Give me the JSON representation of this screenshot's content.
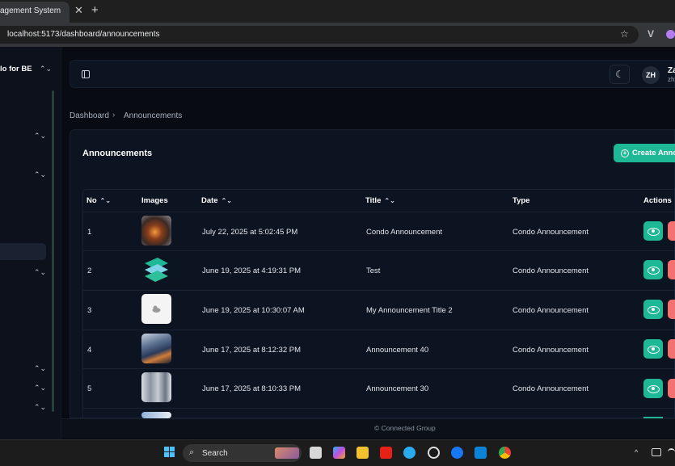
{
  "browser": {
    "tab_title": "agement System",
    "tab_close": "✕",
    "new_tab": "+",
    "url": "localhost:5173/dashboard/announcements",
    "star": "☆",
    "extension": "V"
  },
  "sidebar": {
    "title": "lo for BE",
    "title_chevron": "⌃⌄",
    "chevrons": [
      "⌃⌄",
      "⌃⌄",
      "⌃⌄",
      "⌃⌄",
      "⌃⌄",
      "⌃⌄"
    ]
  },
  "header": {
    "theme_icon": "☾",
    "avatar_initials": "ZH",
    "user_name": "Za",
    "user_email": "zh"
  },
  "breadcrumb": {
    "home": "Dashboard",
    "separator": "›",
    "current": "Announcements"
  },
  "page": {
    "title": "Announcements",
    "create_button": "Create Annou",
    "create_icon": "+"
  },
  "table": {
    "columns": [
      {
        "label": "No",
        "sortable": true
      },
      {
        "label": "Images",
        "sortable": false
      },
      {
        "label": "Date",
        "sortable": true
      },
      {
        "label": "Title",
        "sortable": true
      },
      {
        "label": "Type",
        "sortable": false
      },
      {
        "label": "Actions",
        "sortable": false
      }
    ],
    "sort_icon": "⌃⌄",
    "rows": [
      {
        "no": "1",
        "date": "July 22, 2025 at 5:02:45 PM",
        "title": "Condo Announcement",
        "type": "Condo Announcement",
        "image": "photo-orange"
      },
      {
        "no": "2",
        "date": "June 19, 2025 at 4:19:31 PM",
        "title": "Test",
        "type": "Condo Announcement",
        "image": "logo-cube"
      },
      {
        "no": "3",
        "date": "June 19, 2025 at 10:30:07 AM",
        "title": "My Announcement Title 2",
        "type": "Condo Announcement",
        "image": "placeholder-white"
      },
      {
        "no": "4",
        "date": "June 17, 2025 at 8:12:32 PM",
        "title": "Announcement 40",
        "type": "Condo Announcement",
        "image": "photo-city"
      },
      {
        "no": "5",
        "date": "June 17, 2025 at 8:10:33 PM",
        "title": "Announcement 30",
        "type": "Condo Announcement",
        "image": "photo-building"
      }
    ]
  },
  "footer": {
    "text": "© Connected Group"
  },
  "taskbar": {
    "search_label": "Search",
    "search_icon": "⌕",
    "tray_arrow": "^"
  },
  "colors": {
    "accent": "#1fb897",
    "danger": "#f47171",
    "background": "#080b12",
    "card": "#0d1421"
  }
}
